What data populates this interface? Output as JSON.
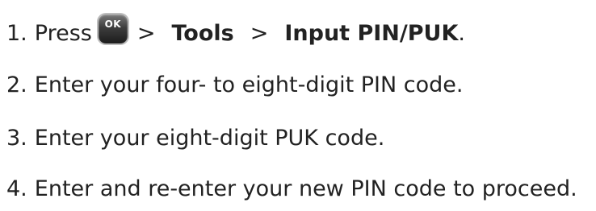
{
  "steps": [
    {
      "number": "1.",
      "press": "Press",
      "ok_key_label": "OK",
      "sep1": ">",
      "menu": "Tools",
      "sep2": ">",
      "item": "Input PIN/PUK",
      "end": "."
    },
    {
      "number": "2.",
      "text": "Enter your four- to eight-digit PIN code."
    },
    {
      "number": "3.",
      "text": "Enter your eight-digit PUK code."
    },
    {
      "number": "4.",
      "text": "Enter and re-enter your new PIN code to proceed."
    }
  ]
}
